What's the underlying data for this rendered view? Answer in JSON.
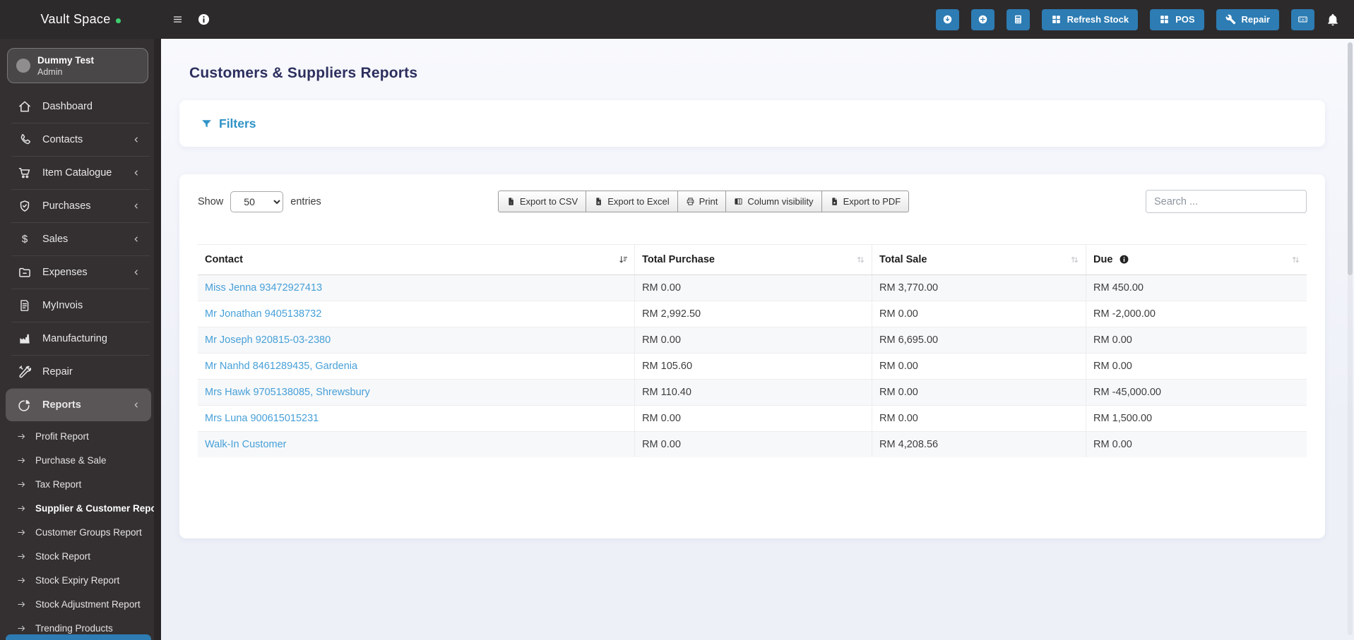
{
  "colors": {
    "accent_blue": "#2d7cb3",
    "link_blue": "#47a0d8",
    "title_navy": "#2d2f5e",
    "filters_blue": "#3093c7",
    "topbar_bg": "#2d2a2b",
    "sidebar_bg": "#343031",
    "status_green": "#3ecf6e"
  },
  "topbar": {
    "brand": "Vault Space",
    "buttons": [
      {
        "icon": "circle-down-icon"
      },
      {
        "icon": "circle-plus-icon"
      },
      {
        "icon": "calculator-icon"
      },
      {
        "icon": "grid-icon",
        "label": "Refresh Stock"
      },
      {
        "icon": "grid-icon",
        "label": "POS"
      },
      {
        "icon": "wrench-icon",
        "label": "Repair"
      },
      {
        "icon": "banknote-icon"
      }
    ]
  },
  "user": {
    "name": "Dummy Test",
    "role": "Admin"
  },
  "sidebar": {
    "items": [
      {
        "label": "Dashboard",
        "icon": "home-icon"
      },
      {
        "label": "Contacts",
        "icon": "phone-icon",
        "chevron": true
      },
      {
        "label": "Item Catalogue",
        "icon": "cart-icon",
        "chevron": true
      },
      {
        "label": "Purchases",
        "icon": "shield-icon",
        "chevron": true
      },
      {
        "label": "Sales",
        "icon": "dollar-icon",
        "chevron": true
      },
      {
        "label": "Expenses",
        "icon": "folder-icon",
        "chevron": true
      },
      {
        "label": "MyInvois",
        "icon": "invoice-icon"
      },
      {
        "label": "Manufacturing",
        "icon": "factory-icon"
      },
      {
        "label": "Repair",
        "icon": "tools-icon"
      },
      {
        "label": "Reports",
        "icon": "pie-chart-icon",
        "chevron": true,
        "active": true
      }
    ],
    "submenu": [
      {
        "label": "Profit Report"
      },
      {
        "label": "Purchase & Sale"
      },
      {
        "label": "Tax Report"
      },
      {
        "label": "Supplier & Customer Repo",
        "active": true
      },
      {
        "label": "Customer Groups Report"
      },
      {
        "label": "Stock Report"
      },
      {
        "label": "Stock Expiry Report"
      },
      {
        "label": "Stock Adjustment Report"
      },
      {
        "label": "Trending Products"
      }
    ]
  },
  "page": {
    "title": "Customers & Suppliers Reports"
  },
  "filters": {
    "label": "Filters"
  },
  "table_controls": {
    "show_label": "Show",
    "entries_label": "entries",
    "page_length": "50",
    "search_placeholder": "Search ...",
    "export_buttons": [
      {
        "label": "Export to CSV",
        "icon": "file-csv-icon"
      },
      {
        "label": "Export to Excel",
        "icon": "file-excel-icon"
      },
      {
        "label": "Print",
        "icon": "printer-icon"
      },
      {
        "label": "Column visibility",
        "icon": "columns-icon"
      },
      {
        "label": "Export to PDF",
        "icon": "file-pdf-icon"
      }
    ]
  },
  "table": {
    "columns": [
      {
        "label": "Contact",
        "sort": "desc-active"
      },
      {
        "label": "Total Purchase",
        "sort": "both"
      },
      {
        "label": "Total Sale",
        "sort": "both"
      },
      {
        "label": "Due",
        "sort": "both",
        "info": true
      }
    ],
    "rows": [
      {
        "contact": "Miss Jenna 93472927413",
        "total_purchase": "RM 0.00",
        "total_sale": "RM 3,770.00",
        "due": "RM 450.00"
      },
      {
        "contact": "Mr Jonathan 9405138732",
        "total_purchase": "RM 2,992.50",
        "total_sale": "RM 0.00",
        "due": "RM -2,000.00"
      },
      {
        "contact": "Mr Joseph 920815-03-2380",
        "total_purchase": "RM 0.00",
        "total_sale": "RM 6,695.00",
        "due": "RM 0.00"
      },
      {
        "contact": "Mr Nanhd 8461289435, Gardenia",
        "total_purchase": "RM 105.60",
        "total_sale": "RM 0.00",
        "due": "RM 0.00"
      },
      {
        "contact": "Mrs Hawk 9705138085, Shrewsbury",
        "total_purchase": "RM 110.40",
        "total_sale": "RM 0.00",
        "due": "RM -45,000.00"
      },
      {
        "contact": "Mrs Luna 900615015231",
        "total_purchase": "RM 0.00",
        "total_sale": "RM 0.00",
        "due": "RM 1,500.00"
      },
      {
        "contact": "Walk-In Customer",
        "total_purchase": "RM 0.00",
        "total_sale": "RM 4,208.56",
        "due": "RM 0.00"
      }
    ]
  }
}
